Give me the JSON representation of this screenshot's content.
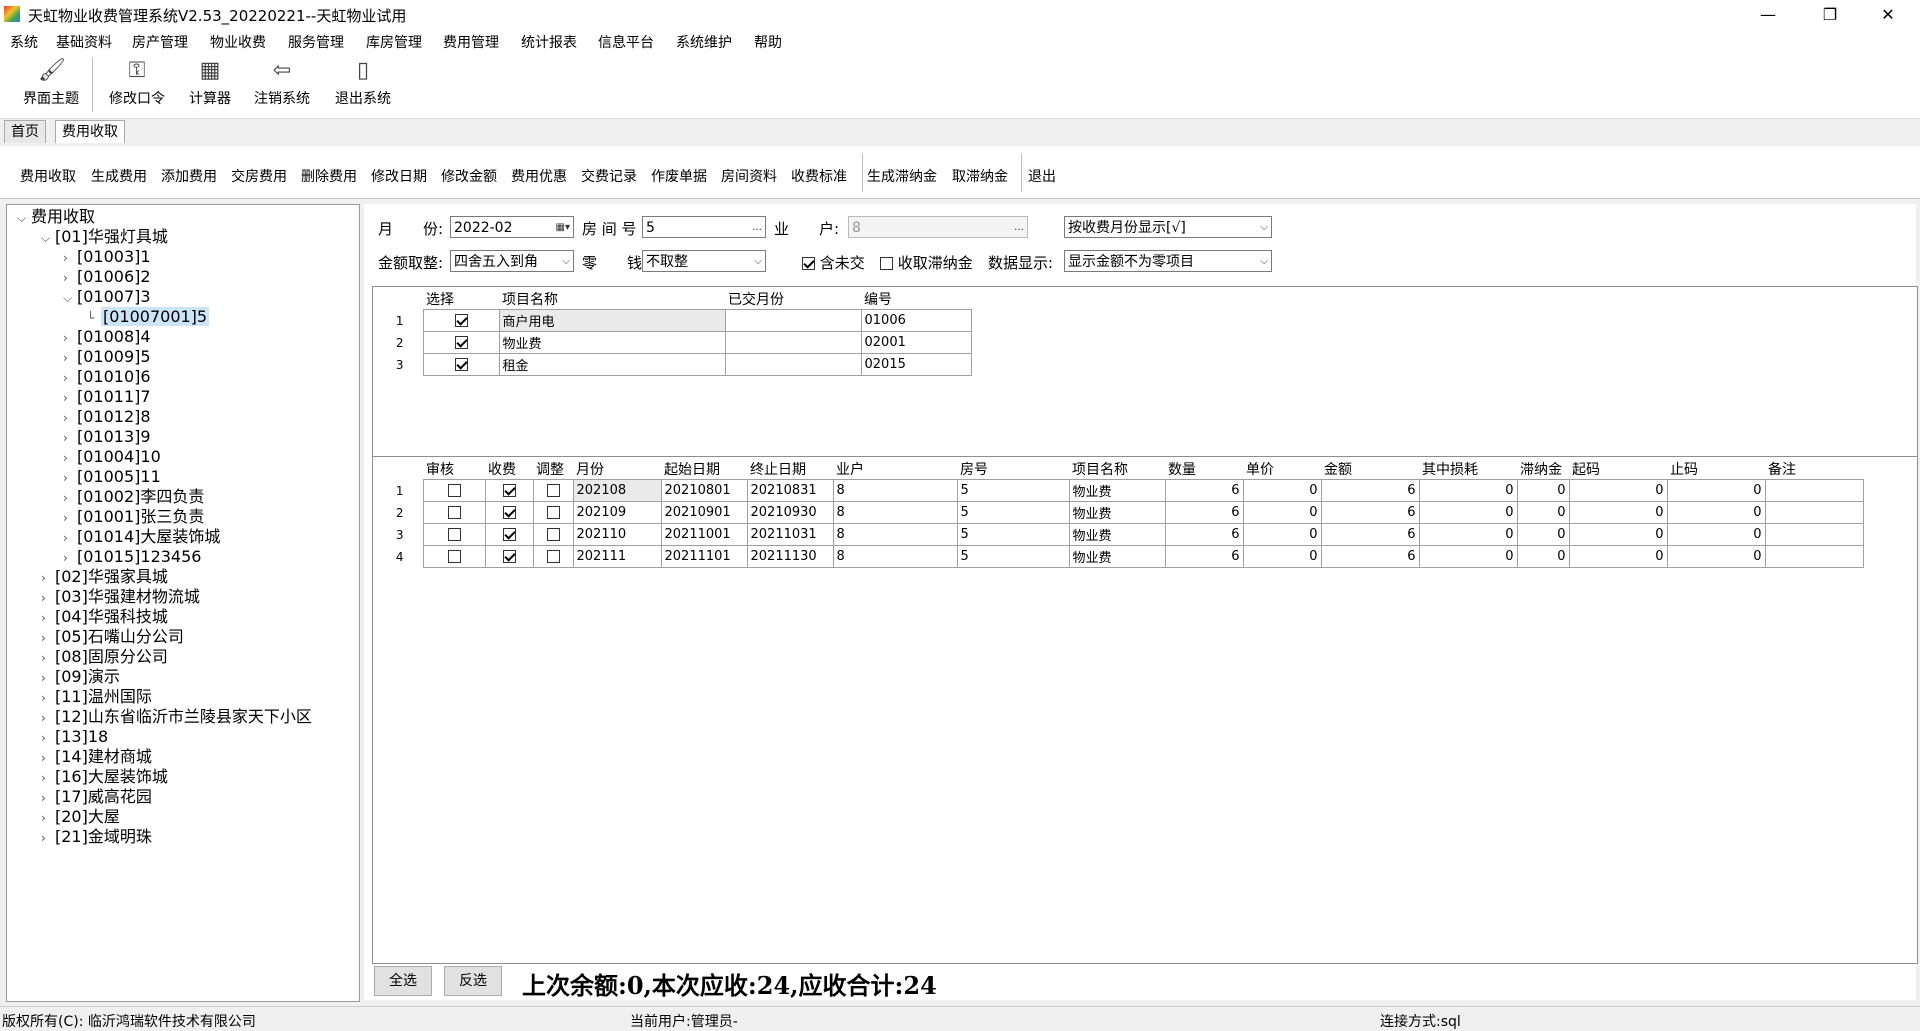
{
  "window": {
    "title": "天虹物业收费管理系统V2.53_20220221--天虹物业试用",
    "minimize": "—",
    "restore": "❐",
    "close": "✕"
  },
  "menu": [
    "系统",
    "基础资料",
    "房产管理",
    "物业收费",
    "服务管理",
    "库房管理",
    "费用管理",
    "统计报表",
    "信息平台",
    "系统维护",
    "帮助"
  ],
  "toolbar": [
    {
      "label": "界面主题",
      "icon": "theme-icon"
    },
    {
      "label": "修改口令",
      "icon": "key-icon"
    },
    {
      "label": "计算器",
      "icon": "calculator-icon"
    },
    {
      "label": "注销系统",
      "icon": "logout-arrow-icon"
    },
    {
      "label": "退出系统",
      "icon": "exit-door-icon"
    }
  ],
  "tabs": [
    "首页",
    "费用收取"
  ],
  "actions": [
    "费用收取",
    "生成费用",
    "添加费用",
    "交房费用",
    "删除费用",
    "修改日期",
    "修改金额",
    "费用优惠",
    "交费记录",
    "作废单据",
    "房间资料",
    "收费标准",
    "生成滞纳金",
    "取滞纳金",
    "退出"
  ],
  "tree": {
    "root": "费用收取",
    "nodes": [
      {
        "label": "[01]华强灯具城",
        "level": 1,
        "expanded": true
      },
      {
        "label": "[01003]1",
        "level": 2,
        "expanded": false
      },
      {
        "label": "[01006]2",
        "level": 2,
        "expanded": false
      },
      {
        "label": "[01007]3",
        "level": 2,
        "expanded": true
      },
      {
        "label": "[01007001]5",
        "level": 3,
        "selected": true
      },
      {
        "label": "[01008]4",
        "level": 2,
        "expanded": false
      },
      {
        "label": "[01009]5",
        "level": 2,
        "expanded": false
      },
      {
        "label": "[01010]6",
        "level": 2,
        "expanded": false
      },
      {
        "label": "[01011]7",
        "level": 2,
        "expanded": false
      },
      {
        "label": "[01012]8",
        "level": 2,
        "expanded": false
      },
      {
        "label": "[01013]9",
        "level": 2,
        "expanded": false
      },
      {
        "label": "[01004]10",
        "level": 2,
        "expanded": false
      },
      {
        "label": "[01005]11",
        "level": 2,
        "expanded": false
      },
      {
        "label": "[01002]李四负责",
        "level": 2,
        "expanded": false
      },
      {
        "label": "[01001]张三负责",
        "level": 2,
        "expanded": false
      },
      {
        "label": "[01014]大屋装饰城",
        "level": 2,
        "expanded": false
      },
      {
        "label": "[01015]123456",
        "level": 2,
        "expanded": false
      },
      {
        "label": "[02]华强家具城",
        "level": 1,
        "expanded": false
      },
      {
        "label": "[03]华强建材物流城",
        "level": 1,
        "expanded": false
      },
      {
        "label": "[04]华强科技城",
        "level": 1,
        "expanded": false
      },
      {
        "label": "[05]石嘴山分公司",
        "level": 1,
        "expanded": false
      },
      {
        "label": "[08]固原分公司",
        "level": 1,
        "expanded": false
      },
      {
        "label": "[09]演示",
        "level": 1,
        "expanded": false
      },
      {
        "label": "[11]温州国际",
        "level": 1,
        "expanded": false
      },
      {
        "label": "[12]山东省临沂市兰陵县家天下小区",
        "level": 1,
        "expanded": false
      },
      {
        "label": "[13]18",
        "level": 1,
        "expanded": false
      },
      {
        "label": "[14]建材商城",
        "level": 1,
        "expanded": false
      },
      {
        "label": "[16]大屋装饰城",
        "level": 1,
        "expanded": false
      },
      {
        "label": "[17]威高花园",
        "level": 1,
        "expanded": false
      },
      {
        "label": "[20]大屋",
        "level": 1,
        "expanded": false
      },
      {
        "label": "[21]金域明珠",
        "level": 1,
        "expanded": false
      }
    ]
  },
  "form": {
    "month_label": "月　　份:",
    "month_value": "2022-02",
    "room_label": "房 间 号",
    "room_value": "5",
    "owner_label": "业　　户:",
    "owner_value": "8",
    "display_mode": "按收费月份显示[√]",
    "rounding_label": "金额取整:",
    "rounding_value": "四舍五入到角",
    "change_label": "零　　钱",
    "change_value": "不取整",
    "include_unpaid_label": "含未交",
    "include_unpaid": true,
    "late_fee_label": "收取滞纳金",
    "late_fee": false,
    "data_display_label": "数据显示:",
    "data_display_value": "显示金额不为零项目"
  },
  "items_grid": {
    "headers": [
      "选择",
      "项目名称",
      "已交月份",
      "编号"
    ],
    "rows": [
      {
        "no": "1",
        "selected": true,
        "name": "商户用电",
        "paid_months": "",
        "code": "01006"
      },
      {
        "no": "2",
        "selected": true,
        "name": "物业费",
        "paid_months": "",
        "code": "02001"
      },
      {
        "no": "3",
        "selected": true,
        "name": "租金",
        "paid_months": "",
        "code": "02015"
      }
    ]
  },
  "fees_grid": {
    "headers": [
      "审核",
      "收费",
      "调整",
      "月份",
      "起始日期",
      "终止日期",
      "业户",
      "房号",
      "项目名称",
      "数量",
      "单价",
      "金额",
      "其中损耗",
      "滞纳金",
      "起码",
      "止码",
      "备注"
    ],
    "rows": [
      {
        "no": "1",
        "audit": false,
        "charge": true,
        "adjust": false,
        "month": "202108",
        "start": "20210801",
        "end": "20210831",
        "owner": "8",
        "room": "5",
        "item": "物业费",
        "qty": "6",
        "price": "0",
        "amount": "6",
        "loss": "0",
        "late": "0",
        "from": "0",
        "to": "0",
        "note": ""
      },
      {
        "no": "2",
        "audit": false,
        "charge": true,
        "adjust": false,
        "month": "202109",
        "start": "20210901",
        "end": "20210930",
        "owner": "8",
        "room": "5",
        "item": "物业费",
        "qty": "6",
        "price": "0",
        "amount": "6",
        "loss": "0",
        "late": "0",
        "from": "0",
        "to": "0",
        "note": ""
      },
      {
        "no": "3",
        "audit": false,
        "charge": true,
        "adjust": false,
        "month": "202110",
        "start": "20211001",
        "end": "20211031",
        "owner": "8",
        "room": "5",
        "item": "物业费",
        "qty": "6",
        "price": "0",
        "amount": "6",
        "loss": "0",
        "late": "0",
        "from": "0",
        "to": "0",
        "note": ""
      },
      {
        "no": "4",
        "audit": false,
        "charge": true,
        "adjust": false,
        "month": "202111",
        "start": "20211101",
        "end": "20211130",
        "owner": "8",
        "room": "5",
        "item": "物业费",
        "qty": "6",
        "price": "0",
        "amount": "6",
        "loss": "0",
        "late": "0",
        "from": "0",
        "to": "0",
        "note": ""
      }
    ]
  },
  "bottom": {
    "select_all": "全选",
    "invert": "反选",
    "summary": "上次余额:0,本次应收:24,应收合计:24"
  },
  "status": {
    "copyright": "版权所有(C):  临沂鸿瑞软件技术有限公司",
    "user": "当前用户:管理员-",
    "connection": "连接方式:sql"
  }
}
